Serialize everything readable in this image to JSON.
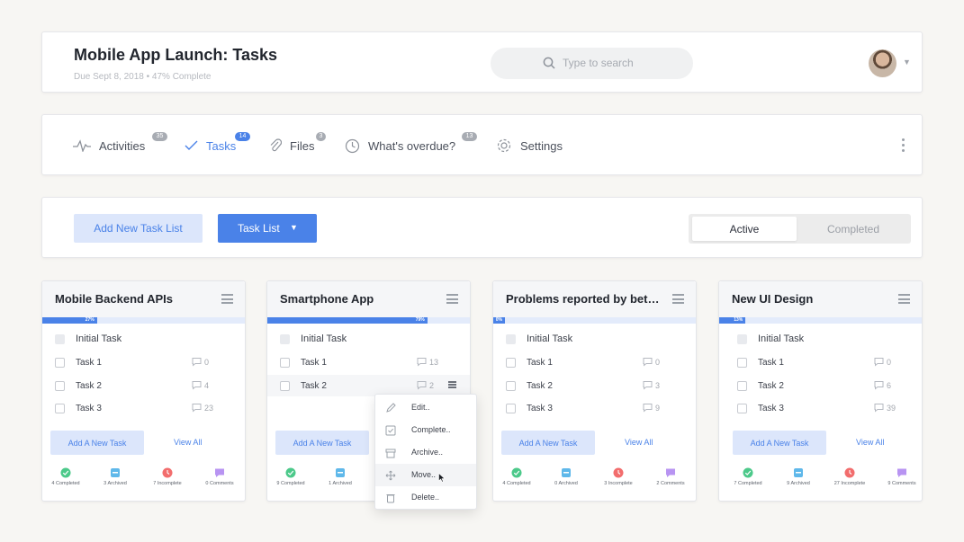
{
  "header": {
    "title": "Mobile App Launch: Tasks",
    "subtitle": "Due Sept 8, 2018 • 47% Complete",
    "search_placeholder": "Type to search"
  },
  "nav": {
    "items": [
      {
        "label": "Activities",
        "badge": "35",
        "icon": "activity-icon"
      },
      {
        "label": "Tasks",
        "badge": "14",
        "icon": "checkmark-icon",
        "active": true
      },
      {
        "label": "Files",
        "badge": "3",
        "icon": "paperclip-icon"
      },
      {
        "label": "What's overdue?",
        "badge": "13",
        "icon": "clock-icon"
      },
      {
        "label": "Settings",
        "icon": "gear-icon"
      }
    ]
  },
  "toolbar": {
    "add_list_label": "Add New Task List",
    "task_list_label": "Task List",
    "segment": {
      "active": "Active",
      "completed": "Completed"
    }
  },
  "cards": [
    {
      "title": "Mobile Backend APIs",
      "progress": "27%",
      "progress_value": 0.27,
      "initial": "Initial Task",
      "tasks": [
        {
          "label": "Task 1",
          "comments": "0"
        },
        {
          "label": "Task 2",
          "comments": "4"
        },
        {
          "label": "Task 3",
          "comments": "23"
        }
      ],
      "add_label": "Add A New Task",
      "view_all": "View All",
      "stats": [
        {
          "label": "4 Completed",
          "icon": "completed-icon"
        },
        {
          "label": "3 Archived",
          "icon": "archive-icon"
        },
        {
          "label": "7 Incomplete",
          "icon": "incomplete-icon"
        },
        {
          "label": "0 Comments",
          "icon": "comments-icon"
        }
      ]
    },
    {
      "title": "Smartphone App",
      "progress": "79%",
      "progress_value": 0.79,
      "initial": "Initial Task",
      "tasks": [
        {
          "label": "Task 1",
          "comments": "13"
        },
        {
          "label": "Task 2",
          "comments": "2"
        }
      ],
      "add_label": "Add A New Task",
      "stats": [
        {
          "label": "9 Completed",
          "icon": "completed-icon"
        },
        {
          "label": "1 Archived",
          "icon": "archive-icon"
        }
      ]
    },
    {
      "title": "Problems reported by beta...",
      "progress": "0%",
      "progress_value": 0,
      "initial": "Initial Task",
      "tasks": [
        {
          "label": "Task 1",
          "comments": "0"
        },
        {
          "label": "Task 2",
          "comments": "3"
        },
        {
          "label": "Task 3",
          "comments": "9"
        }
      ],
      "add_label": "Add A New Task",
      "view_all": "View All",
      "stats": [
        {
          "label": "4 Completed",
          "icon": "completed-icon"
        },
        {
          "label": "0 Archived",
          "icon": "archive-icon"
        },
        {
          "label": "3 Incomplete",
          "icon": "incomplete-icon"
        },
        {
          "label": "2 Comments",
          "icon": "comments-icon"
        }
      ]
    },
    {
      "title": "New UI Design",
      "progress": "13%",
      "progress_value": 0.13,
      "initial": "Initial Task",
      "tasks": [
        {
          "label": "Task 1",
          "comments": "0"
        },
        {
          "label": "Task 2",
          "comments": "6"
        },
        {
          "label": "Task 3",
          "comments": "39"
        }
      ],
      "add_label": "Add A New Task",
      "view_all": "View All",
      "stats": [
        {
          "label": "7 Completed",
          "icon": "completed-icon"
        },
        {
          "label": "9 Archived",
          "icon": "archive-icon"
        },
        {
          "label": "27 Incomplete",
          "icon": "incomplete-icon"
        },
        {
          "label": "9 Comments",
          "icon": "comments-icon"
        }
      ]
    }
  ],
  "context_menu": [
    {
      "label": "Edit..",
      "icon": "pencil-icon"
    },
    {
      "label": "Complete..",
      "icon": "check-square-icon"
    },
    {
      "label": "Archive..",
      "icon": "archive-box-icon"
    },
    {
      "label": "Move..",
      "icon": "move-icon"
    },
    {
      "label": "Delete..",
      "icon": "trash-icon"
    }
  ],
  "colors": {
    "accent": "#4a82e8",
    "accent_light": "#dce6fb",
    "completed": "#4cc98a",
    "archived": "#5fb8ea",
    "incomplete": "#f26d6d",
    "comments": "#b894f2"
  }
}
